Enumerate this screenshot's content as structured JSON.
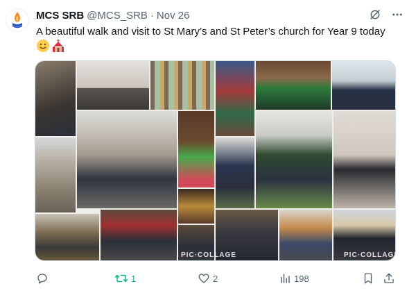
{
  "tweet": {
    "author_name": "MCS SRB",
    "handle": "@MCS_SRB",
    "separator": "·",
    "date": "Nov 26",
    "text": "A beautiful walk and visit to St Mary’s and St Peter’s church for Year 9 today",
    "emojis": [
      "slightly-smiling-face-emoji",
      "church-emoji"
    ]
  },
  "media": {
    "alt": "Pic Collage of students visiting St Mary’s and St Peter’s church",
    "watermark_left": "PIC·COLLAGE",
    "watermark_right": "PIC·COLLAGE"
  },
  "actions": {
    "reply_count": "",
    "retweet_count": "1",
    "like_count": "2",
    "views_count": "198"
  },
  "colors": {
    "text": "#0f1419",
    "secondary": "#536471",
    "retweet_active": "#00ba7c",
    "border": "#cfd9de"
  }
}
